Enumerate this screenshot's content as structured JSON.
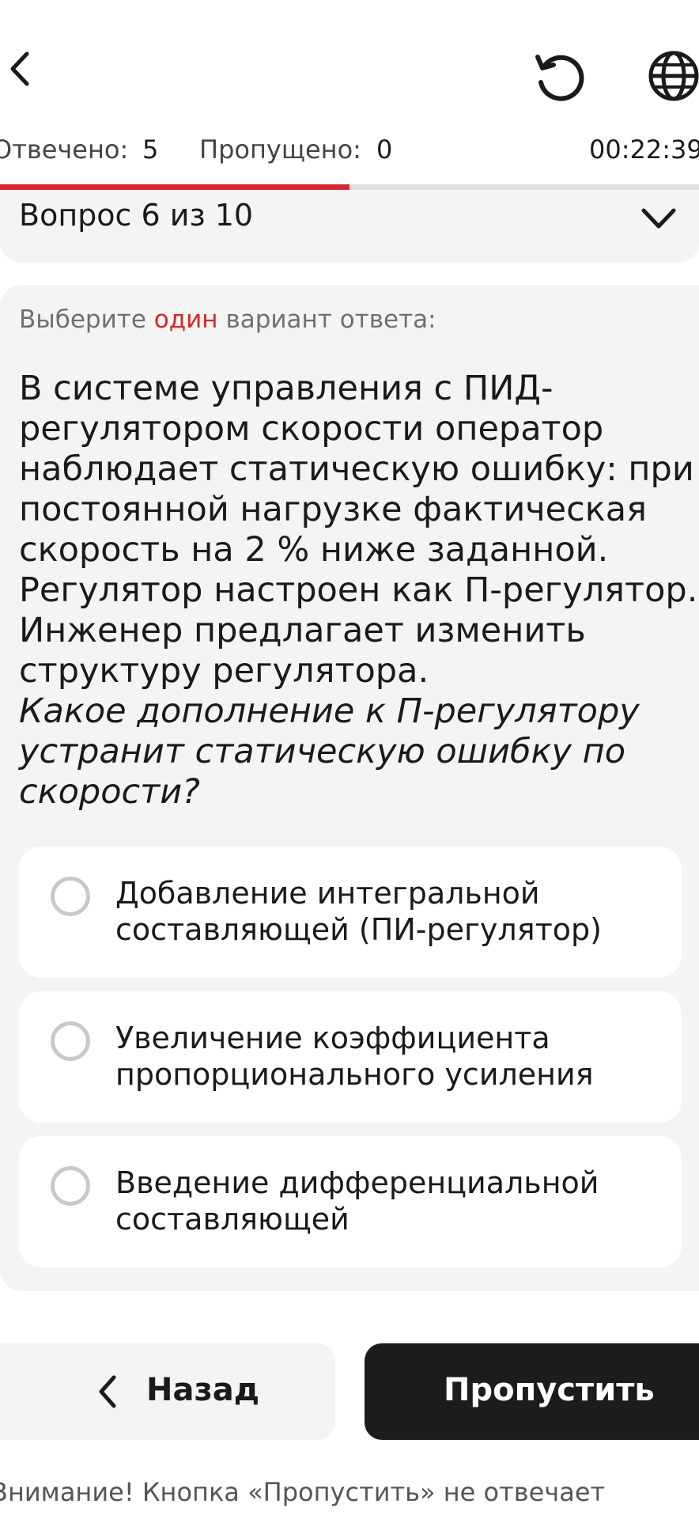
{
  "header": {
    "back_icon": "chevron-left-icon",
    "reset_icon": "refresh-icon",
    "language_icon": "globe-icon"
  },
  "stats": {
    "answered_label": "Отвечено:",
    "answered_value": "5",
    "skipped_label": "Пропущено:",
    "skipped_value": "0",
    "timer": "00:22:39"
  },
  "progress": {
    "fraction": 0.5
  },
  "question_header": {
    "title": "Вопрос 6 из 10",
    "expand_icon": "chevron-down-icon"
  },
  "question": {
    "hint_prefix": "Выберите",
    "hint_accent": "один",
    "hint_suffix": "вариант ответа:",
    "body": "В системе управления с ПИД-регулятором скорости оператор наблюдает статическую ошибку: при постоянной нагрузке фактическая скорость на 2 % ниже заданной. Регулятор настроен как П-регулятор. Инженер предлагает изменить структуру регулятора.",
    "prompt": "Какое дополнение к П-регулятору устранит статическую ошибку по скорости?"
  },
  "options": [
    {
      "label": "Добавление интегральной составляющей (ПИ-регулятор)"
    },
    {
      "label": "Увеличение коэффициента пропорционального усиления"
    },
    {
      "label": "Введение дифференциальной составляющей"
    }
  ],
  "buttons": {
    "back_label": "Назад",
    "skip_label": "Пропустить"
  },
  "warning": "Внимание! Кнопка «Пропустить» не отвечает",
  "colors": {
    "accent": "#d7262b",
    "card_bg": "#f4f4f4",
    "dark_button": "#1c1c1c"
  }
}
